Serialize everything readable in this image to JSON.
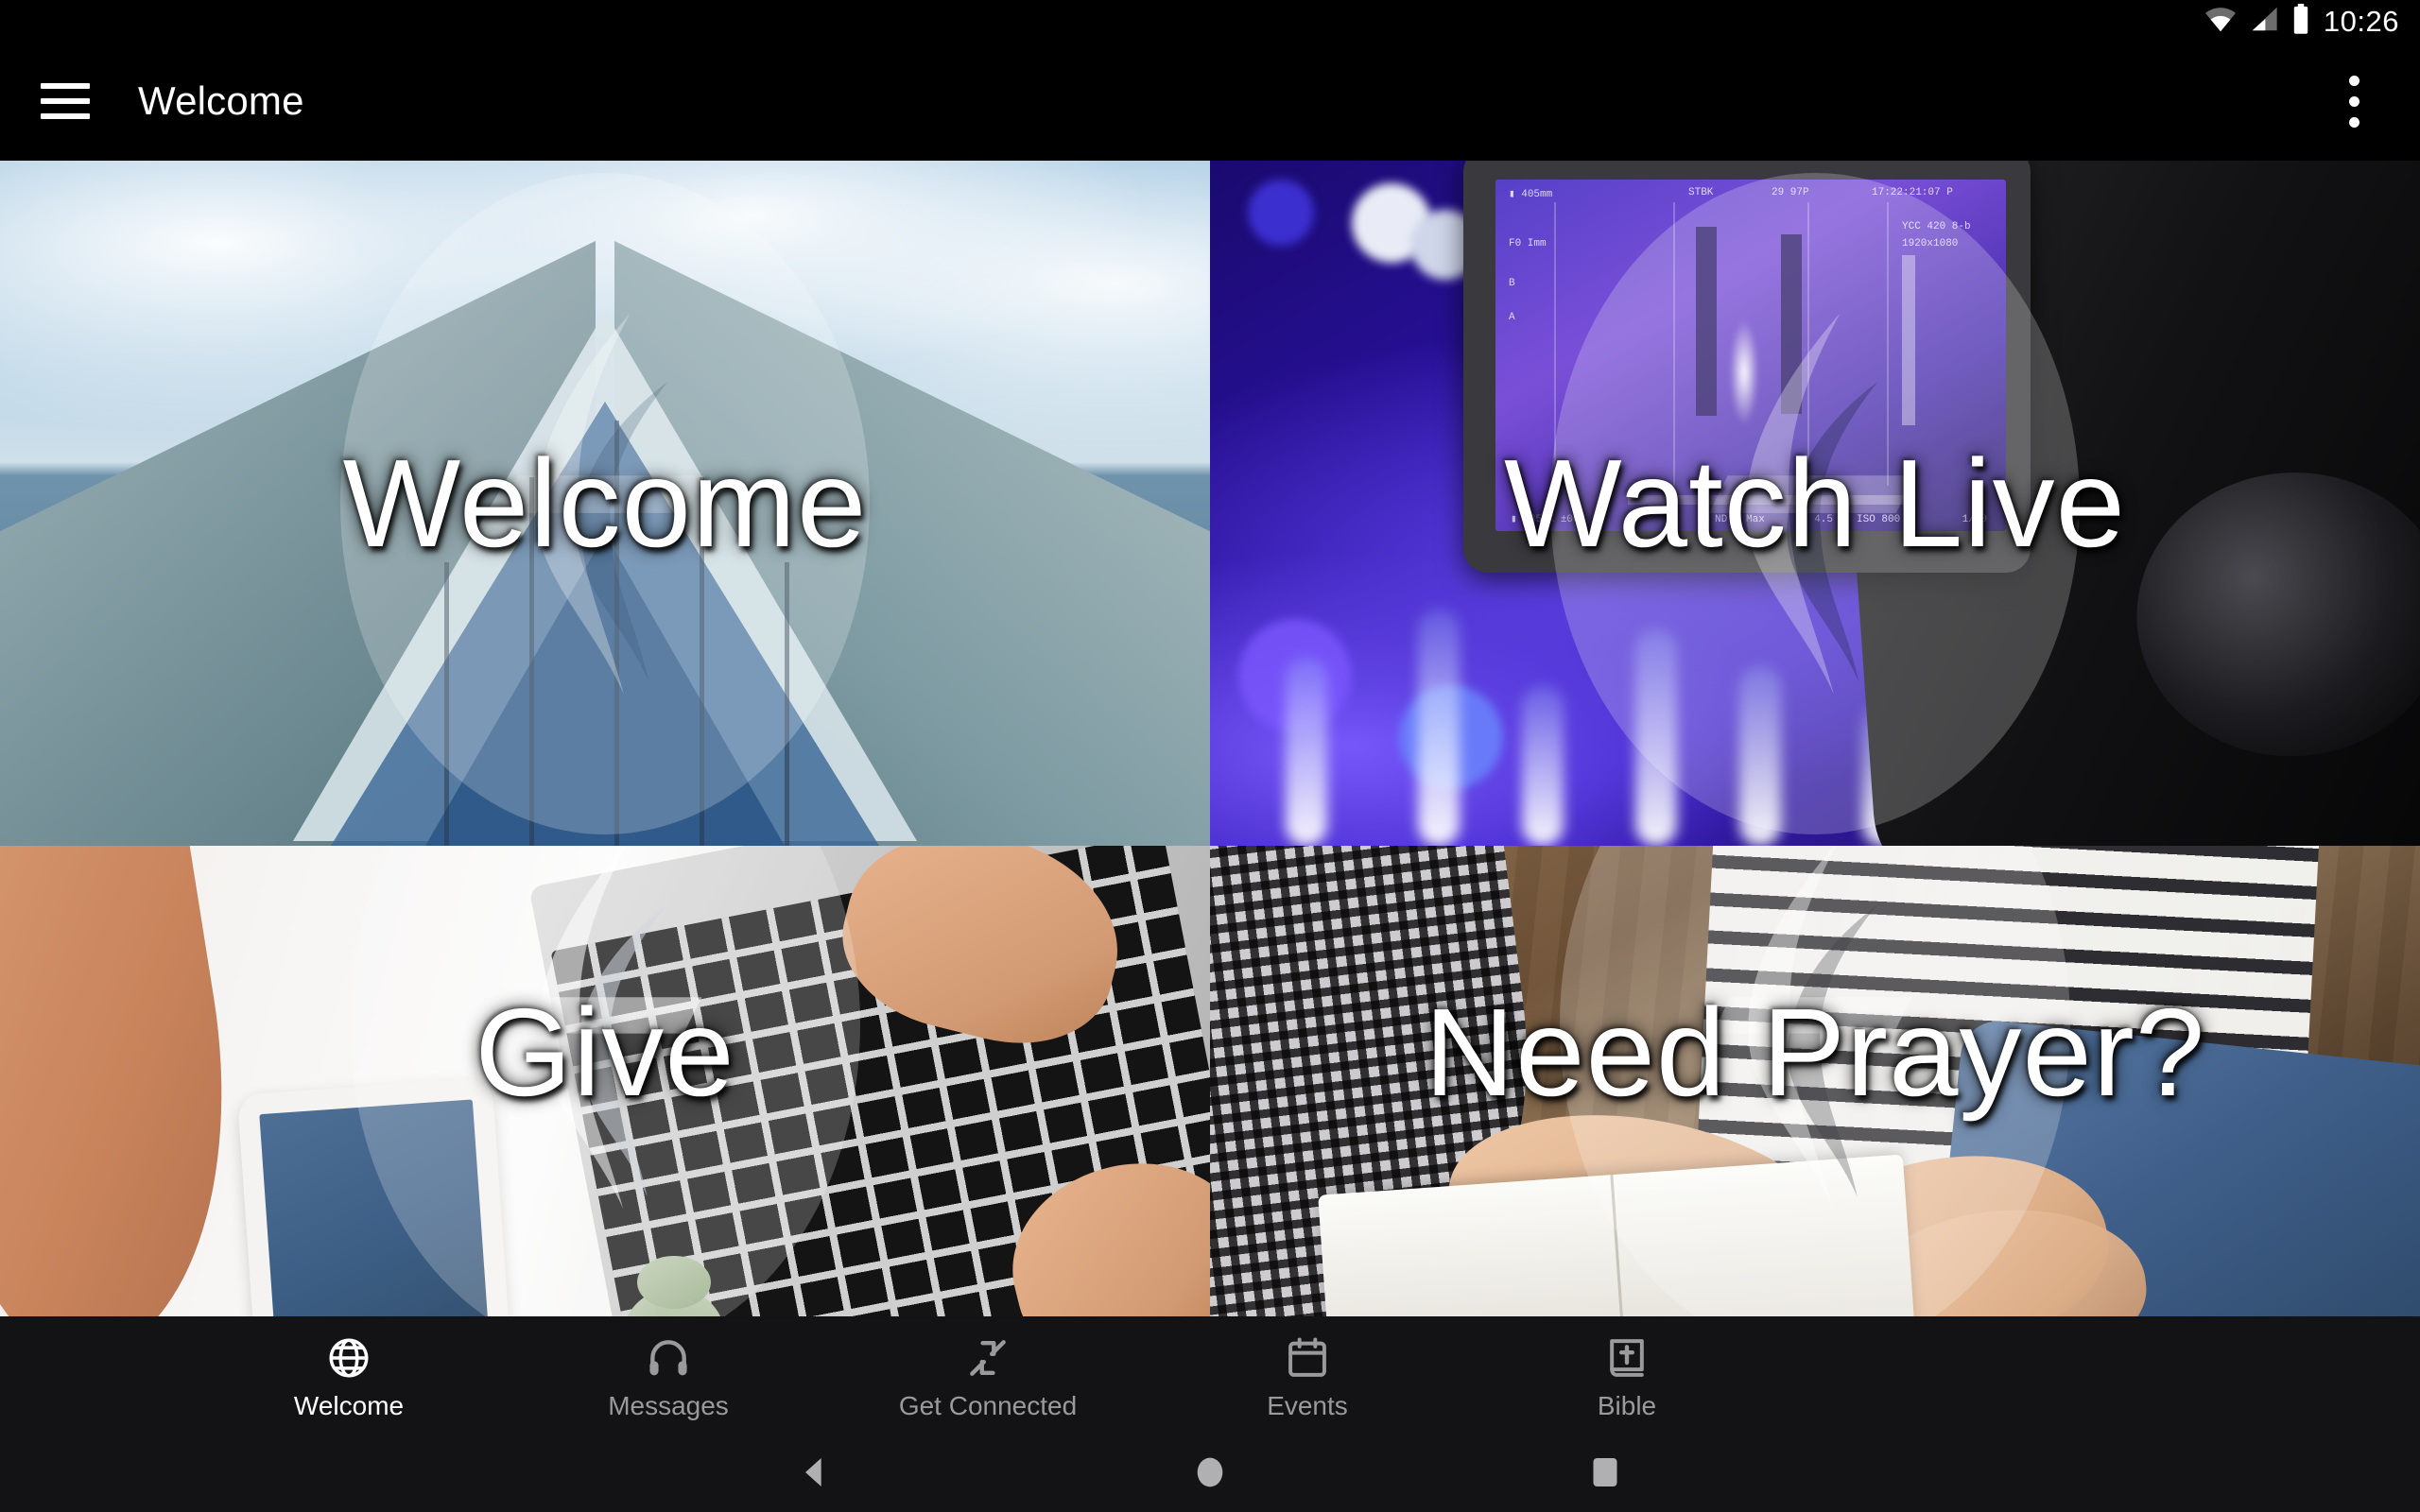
{
  "status_bar": {
    "time": "10:26",
    "icons": [
      "wifi-icon",
      "cellular-signal-icon",
      "battery-icon"
    ]
  },
  "app_bar": {
    "menu_icon": "hamburger-menu-icon",
    "title": "Welcome",
    "overflow_icon": "more-vertical-icon"
  },
  "tiles": [
    {
      "label": "Welcome",
      "image": "church-building-exterior-with-clouds"
    },
    {
      "label": "Watch Live",
      "image": "video-camera-with-lcd-viewfinder-stage-lights"
    },
    {
      "label": "Give",
      "image": "desk-with-phone-laptop-and-plant"
    },
    {
      "label": "Need Prayer?",
      "image": "hands-held-in-prayer-over-open-bible"
    }
  ],
  "bottom_nav": {
    "items": [
      {
        "label": "Welcome",
        "icon": "globe-icon",
        "active": true
      },
      {
        "label": "Messages",
        "icon": "headphones-icon",
        "active": false
      },
      {
        "label": "Get Connected",
        "icon": "connect-arrows-icon",
        "active": false
      },
      {
        "label": "Events",
        "icon": "calendar-icon",
        "active": false
      },
      {
        "label": "Bible",
        "icon": "bible-book-icon",
        "active": false
      }
    ]
  },
  "system_nav": {
    "buttons": [
      {
        "name": "back-button",
        "icon": "triangle-left-icon"
      },
      {
        "name": "home-button",
        "icon": "circle-icon"
      },
      {
        "name": "recents-button",
        "icon": "square-icon"
      }
    ]
  },
  "colors": {
    "app_bar_background": "#000000",
    "bottom_nav_background": "#131315",
    "active_tab": "#ffffff",
    "inactive_tab": "#9a9a9d",
    "caption_text": "#ffffff"
  },
  "watermark": "church-logo-circular-brush-monogram"
}
